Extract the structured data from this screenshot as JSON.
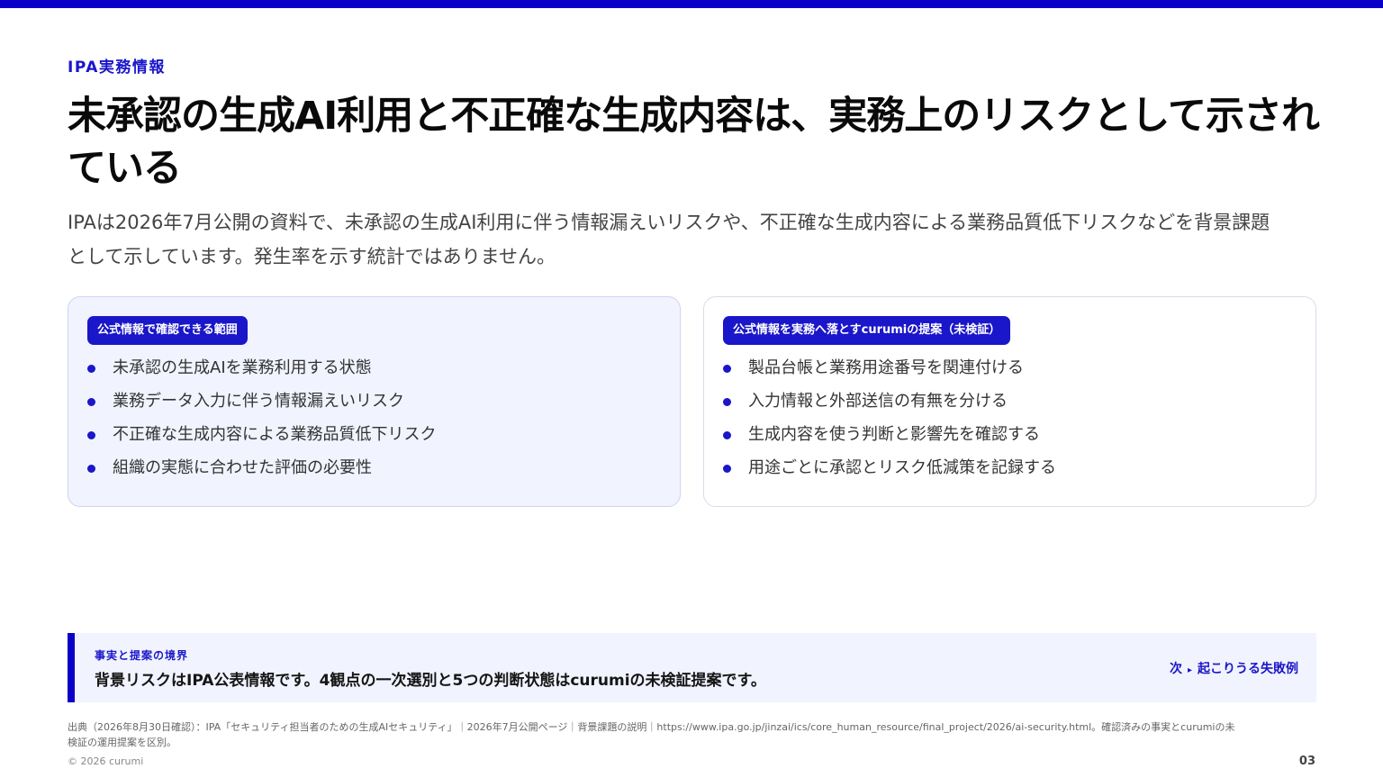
{
  "eyebrow": "IPA実務情報",
  "title": "未承認の生成AI利用と不正確な生成内容は、実務上のリスクとして示されている",
  "lead": "IPAは2026年7月公開の資料で、未承認の生成AI利用に伴う情報漏えいリスクや、不正確な生成内容による業務品質低下リスクなどを背景課題として示しています。発生率を示す統計ではありません。",
  "cards": [
    {
      "badge": "公式情報で確認できる範囲",
      "items": [
        "未承認の生成AIを業務利用する状態",
        "業務データ入力に伴う情報漏えいリスク",
        "不正確な生成内容による業務品質低下リスク",
        "組織の実態に合わせた評価の必要性"
      ]
    },
    {
      "badge": "公式情報を実務へ落とすcurumiの提案（未検証）",
      "items": [
        "製品台帳と業務用途番号を関連付ける",
        "入力情報と外部送信の有無を分ける",
        "生成内容を使う判断と影響先を確認する",
        "用途ごとに承認とリスク低減策を記録する"
      ]
    }
  ],
  "callout": {
    "label": "事実と提案の境界",
    "text": "背景リスクはIPA公表情報です。4観点の一次選別と5つの判断状態はcurumiの未検証提案です。",
    "next_prefix": "次",
    "next_label": "起こりうる失敗例"
  },
  "source": "出典（2026年8月30日確認）：IPA「セキュリティ担当者のための生成AIセキュリティ」｜2026年7月公開ページ｜背景課題の説明｜https://www.ipa.go.jp/jinzai/ics/core_human_resource/final_project/2026/ai-security.html。確認済みの事実とcurumiの未検証の運用提案を区別。",
  "copyright": "© 2026 curumi",
  "page_number": "03",
  "colors": {
    "accent": "#1a16c9",
    "top_bar": "#0b00c7",
    "card_tint": "#f1f3fe"
  }
}
